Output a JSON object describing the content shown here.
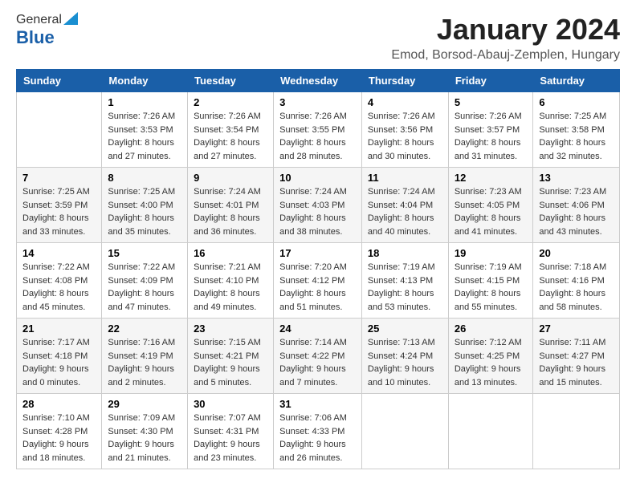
{
  "logo": {
    "general": "General",
    "blue": "Blue"
  },
  "header": {
    "title": "January 2024",
    "subtitle": "Emod, Borsod-Abauj-Zemplen, Hungary"
  },
  "weekdays": [
    "Sunday",
    "Monday",
    "Tuesday",
    "Wednesday",
    "Thursday",
    "Friday",
    "Saturday"
  ],
  "weeks": [
    [
      {
        "day": "",
        "sunrise": "",
        "sunset": "",
        "daylight": ""
      },
      {
        "day": "1",
        "sunrise": "Sunrise: 7:26 AM",
        "sunset": "Sunset: 3:53 PM",
        "daylight": "Daylight: 8 hours and 27 minutes."
      },
      {
        "day": "2",
        "sunrise": "Sunrise: 7:26 AM",
        "sunset": "Sunset: 3:54 PM",
        "daylight": "Daylight: 8 hours and 27 minutes."
      },
      {
        "day": "3",
        "sunrise": "Sunrise: 7:26 AM",
        "sunset": "Sunset: 3:55 PM",
        "daylight": "Daylight: 8 hours and 28 minutes."
      },
      {
        "day": "4",
        "sunrise": "Sunrise: 7:26 AM",
        "sunset": "Sunset: 3:56 PM",
        "daylight": "Daylight: 8 hours and 30 minutes."
      },
      {
        "day": "5",
        "sunrise": "Sunrise: 7:26 AM",
        "sunset": "Sunset: 3:57 PM",
        "daylight": "Daylight: 8 hours and 31 minutes."
      },
      {
        "day": "6",
        "sunrise": "Sunrise: 7:25 AM",
        "sunset": "Sunset: 3:58 PM",
        "daylight": "Daylight: 8 hours and 32 minutes."
      }
    ],
    [
      {
        "day": "7",
        "sunrise": "Sunrise: 7:25 AM",
        "sunset": "Sunset: 3:59 PM",
        "daylight": "Daylight: 8 hours and 33 minutes."
      },
      {
        "day": "8",
        "sunrise": "Sunrise: 7:25 AM",
        "sunset": "Sunset: 4:00 PM",
        "daylight": "Daylight: 8 hours and 35 minutes."
      },
      {
        "day": "9",
        "sunrise": "Sunrise: 7:24 AM",
        "sunset": "Sunset: 4:01 PM",
        "daylight": "Daylight: 8 hours and 36 minutes."
      },
      {
        "day": "10",
        "sunrise": "Sunrise: 7:24 AM",
        "sunset": "Sunset: 4:03 PM",
        "daylight": "Daylight: 8 hours and 38 minutes."
      },
      {
        "day": "11",
        "sunrise": "Sunrise: 7:24 AM",
        "sunset": "Sunset: 4:04 PM",
        "daylight": "Daylight: 8 hours and 40 minutes."
      },
      {
        "day": "12",
        "sunrise": "Sunrise: 7:23 AM",
        "sunset": "Sunset: 4:05 PM",
        "daylight": "Daylight: 8 hours and 41 minutes."
      },
      {
        "day": "13",
        "sunrise": "Sunrise: 7:23 AM",
        "sunset": "Sunset: 4:06 PM",
        "daylight": "Daylight: 8 hours and 43 minutes."
      }
    ],
    [
      {
        "day": "14",
        "sunrise": "Sunrise: 7:22 AM",
        "sunset": "Sunset: 4:08 PM",
        "daylight": "Daylight: 8 hours and 45 minutes."
      },
      {
        "day": "15",
        "sunrise": "Sunrise: 7:22 AM",
        "sunset": "Sunset: 4:09 PM",
        "daylight": "Daylight: 8 hours and 47 minutes."
      },
      {
        "day": "16",
        "sunrise": "Sunrise: 7:21 AM",
        "sunset": "Sunset: 4:10 PM",
        "daylight": "Daylight: 8 hours and 49 minutes."
      },
      {
        "day": "17",
        "sunrise": "Sunrise: 7:20 AM",
        "sunset": "Sunset: 4:12 PM",
        "daylight": "Daylight: 8 hours and 51 minutes."
      },
      {
        "day": "18",
        "sunrise": "Sunrise: 7:19 AM",
        "sunset": "Sunset: 4:13 PM",
        "daylight": "Daylight: 8 hours and 53 minutes."
      },
      {
        "day": "19",
        "sunrise": "Sunrise: 7:19 AM",
        "sunset": "Sunset: 4:15 PM",
        "daylight": "Daylight: 8 hours and 55 minutes."
      },
      {
        "day": "20",
        "sunrise": "Sunrise: 7:18 AM",
        "sunset": "Sunset: 4:16 PM",
        "daylight": "Daylight: 8 hours and 58 minutes."
      }
    ],
    [
      {
        "day": "21",
        "sunrise": "Sunrise: 7:17 AM",
        "sunset": "Sunset: 4:18 PM",
        "daylight": "Daylight: 9 hours and 0 minutes."
      },
      {
        "day": "22",
        "sunrise": "Sunrise: 7:16 AM",
        "sunset": "Sunset: 4:19 PM",
        "daylight": "Daylight: 9 hours and 2 minutes."
      },
      {
        "day": "23",
        "sunrise": "Sunrise: 7:15 AM",
        "sunset": "Sunset: 4:21 PM",
        "daylight": "Daylight: 9 hours and 5 minutes."
      },
      {
        "day": "24",
        "sunrise": "Sunrise: 7:14 AM",
        "sunset": "Sunset: 4:22 PM",
        "daylight": "Daylight: 9 hours and 7 minutes."
      },
      {
        "day": "25",
        "sunrise": "Sunrise: 7:13 AM",
        "sunset": "Sunset: 4:24 PM",
        "daylight": "Daylight: 9 hours and 10 minutes."
      },
      {
        "day": "26",
        "sunrise": "Sunrise: 7:12 AM",
        "sunset": "Sunset: 4:25 PM",
        "daylight": "Daylight: 9 hours and 13 minutes."
      },
      {
        "day": "27",
        "sunrise": "Sunrise: 7:11 AM",
        "sunset": "Sunset: 4:27 PM",
        "daylight": "Daylight: 9 hours and 15 minutes."
      }
    ],
    [
      {
        "day": "28",
        "sunrise": "Sunrise: 7:10 AM",
        "sunset": "Sunset: 4:28 PM",
        "daylight": "Daylight: 9 hours and 18 minutes."
      },
      {
        "day": "29",
        "sunrise": "Sunrise: 7:09 AM",
        "sunset": "Sunset: 4:30 PM",
        "daylight": "Daylight: 9 hours and 21 minutes."
      },
      {
        "day": "30",
        "sunrise": "Sunrise: 7:07 AM",
        "sunset": "Sunset: 4:31 PM",
        "daylight": "Daylight: 9 hours and 23 minutes."
      },
      {
        "day": "31",
        "sunrise": "Sunrise: 7:06 AM",
        "sunset": "Sunset: 4:33 PM",
        "daylight": "Daylight: 9 hours and 26 minutes."
      },
      {
        "day": "",
        "sunrise": "",
        "sunset": "",
        "daylight": ""
      },
      {
        "day": "",
        "sunrise": "",
        "sunset": "",
        "daylight": ""
      },
      {
        "day": "",
        "sunrise": "",
        "sunset": "",
        "daylight": ""
      }
    ]
  ]
}
